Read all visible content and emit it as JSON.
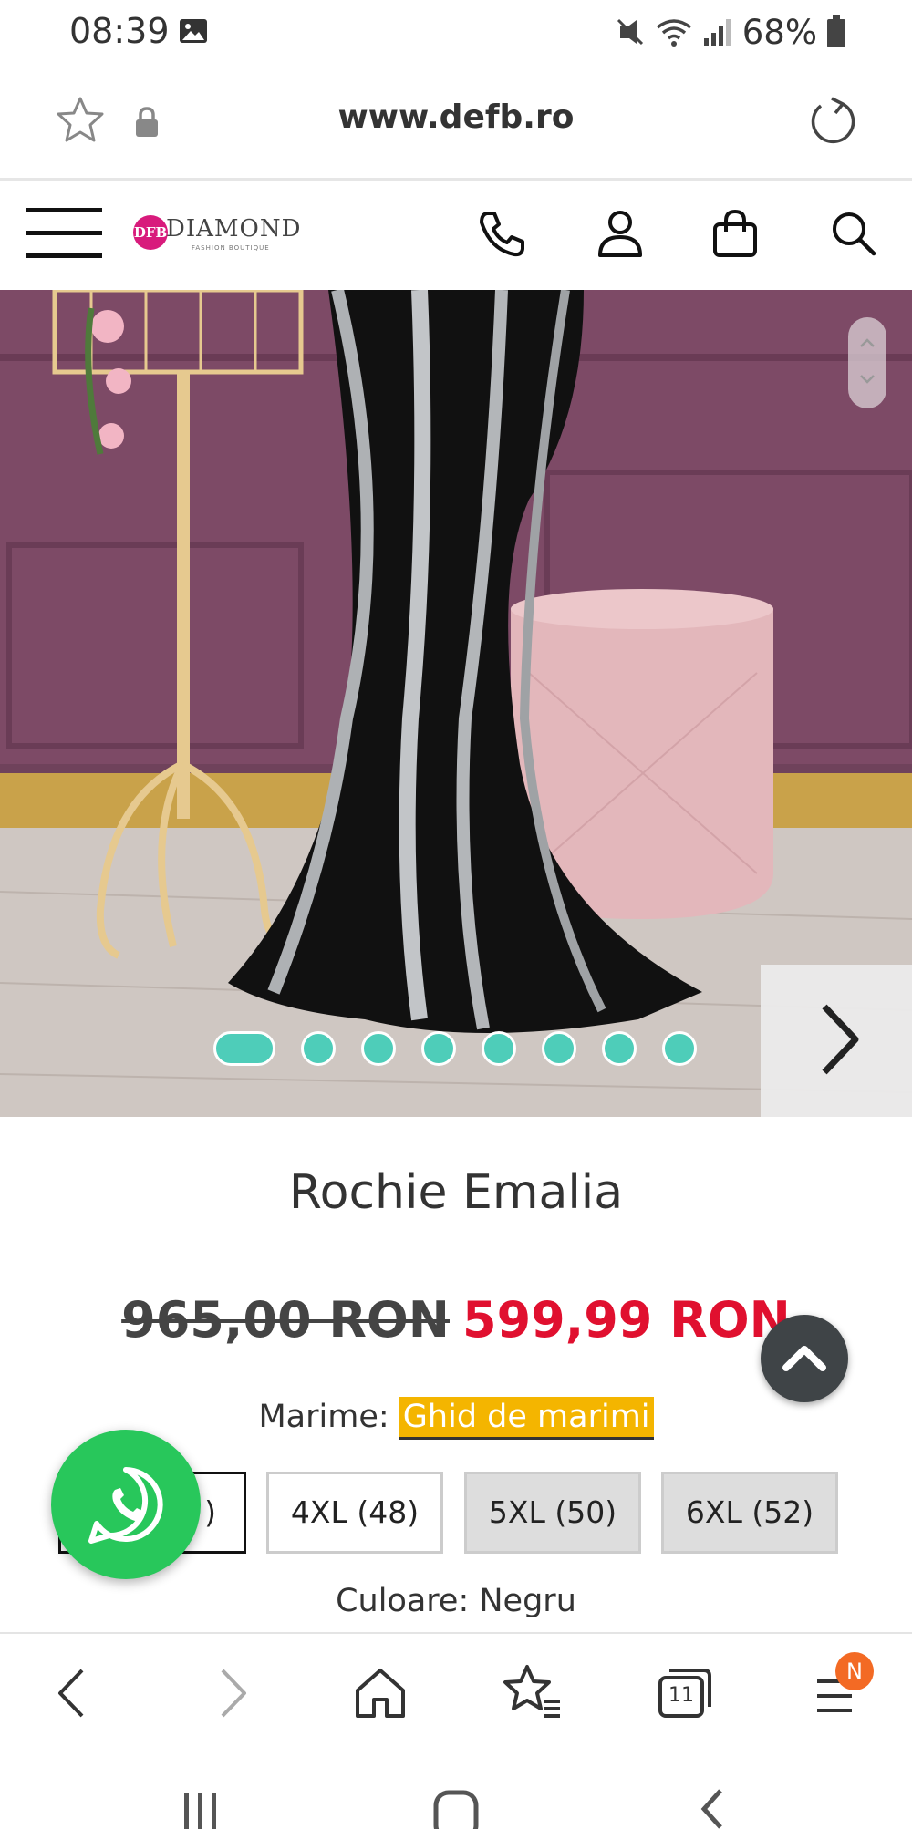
{
  "status_bar": {
    "time": "08:39",
    "battery": "68%",
    "icons": [
      "gallery-icon",
      "mute-icon",
      "wifi-icon",
      "signal-icon",
      "battery-icon"
    ]
  },
  "browser": {
    "url": "www.defb.ro",
    "icons": [
      "star-icon",
      "lock-icon",
      "reload-icon"
    ]
  },
  "site_header": {
    "logo_mark": "DFB",
    "logo_text": "DIAMOND",
    "logo_sub": "FASHION BOUTIQUE",
    "icons": [
      "menu-icon",
      "phone-icon",
      "account-icon",
      "bag-icon",
      "search-icon"
    ]
  },
  "product": {
    "title": "Rochie Emalia",
    "old_price": "965,00 RON",
    "new_price": "599,99 RON",
    "size_label": "Marime:",
    "size_guide": "Ghid de marimi",
    "sizes": [
      {
        "label": "3XL (46)",
        "shown": ")",
        "state": "selected"
      },
      {
        "label": "4XL (48)",
        "state": "available"
      },
      {
        "label": "5XL (50)",
        "state": "unavailable"
      },
      {
        "label": "6XL (52)",
        "state": "unavailable"
      }
    ],
    "color_label": "Culoare:",
    "color_value": "Negru",
    "color_text": "Culoare: Negru",
    "gallery": {
      "image_count": 8,
      "active_index": 1
    }
  },
  "floating": {
    "scroll_top": "chevron-up-icon",
    "whatsapp": "whatsapp-icon"
  },
  "browser_nav": {
    "tab_count": "11",
    "menu_badge": "N",
    "icons": [
      "back-icon",
      "forward-icon",
      "home-icon",
      "bookmarks-icon",
      "tabs-icon",
      "browser-menu-icon"
    ]
  },
  "colors": {
    "accent_teal": "#4ecdb9",
    "price_red": "#e0102f",
    "guide_yellow": "#f4b500",
    "whatsapp_green": "#28c75b",
    "badge_orange": "#f36a24"
  }
}
